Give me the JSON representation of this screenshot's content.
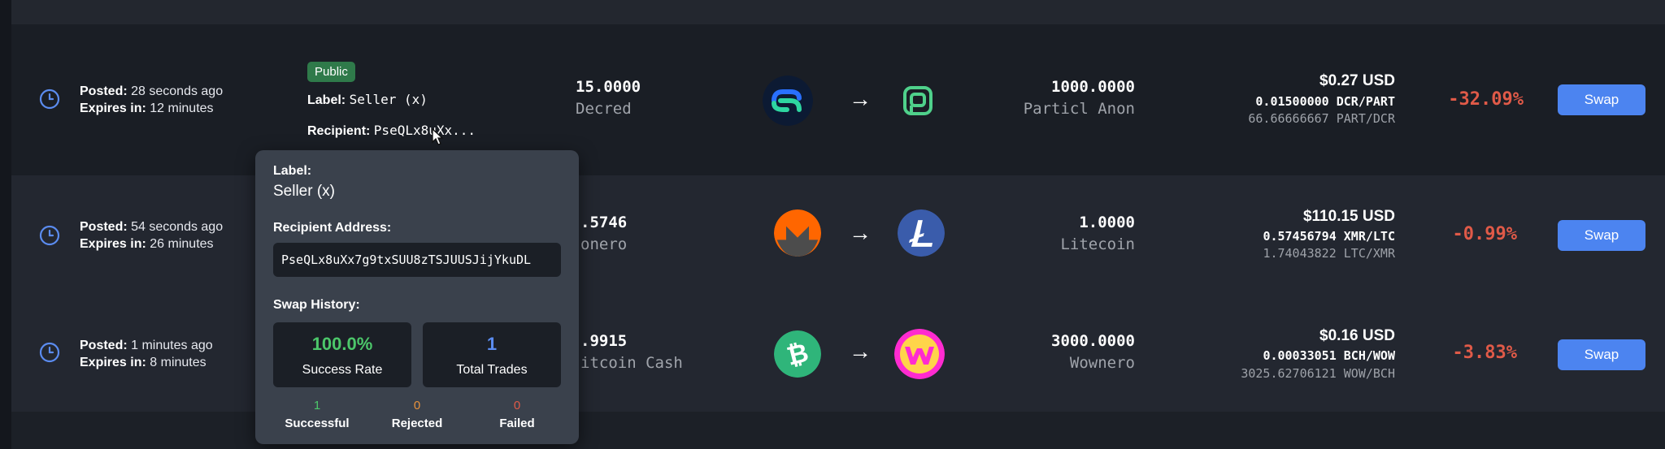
{
  "colors": {
    "background": "#181c24",
    "accent_blue": "#4c84f0",
    "negative": "#e05a48",
    "success_green": "#4cc76a",
    "warning_orange": "#e8923c",
    "failed_red": "#e05a48",
    "public_badge": "#2f7a4a"
  },
  "rows": [
    {
      "posted_label": "Posted:",
      "posted_value": "28 seconds ago",
      "expires_label": "Expires in:",
      "expires_value": "12 minutes",
      "badge": "Public",
      "label_key": "Label:",
      "label_value": "Seller (x)",
      "recipient_key": "Recipient:",
      "recipient_value": "PseQLx8uXx...",
      "from_amount": "15.0000",
      "from_coin": "Decred",
      "from_icon": "decred-icon",
      "arrow": "→",
      "to_amount": "1000.0000",
      "to_coin": "Particl Anon",
      "to_icon": "particl-icon",
      "usd": "$0.27 USD",
      "rate": "0.01500000 DCR/PART",
      "inverse_rate": "66.66666667 PART/DCR",
      "percent": "-32.09%",
      "swap_label": "Swap"
    },
    {
      "posted_label": "Posted:",
      "posted_value": "54 seconds ago",
      "expires_label": "Expires in:",
      "expires_value": "26 minutes",
      "from_amount_partial": ".5746",
      "from_coin_partial": "onero",
      "from_icon": "monero-icon",
      "arrow": "→",
      "to_amount": "1.0000",
      "to_coin": "Litecoin",
      "to_icon": "litecoin-icon",
      "usd": "$110.15 USD",
      "rate": "0.57456794 XMR/LTC",
      "inverse_rate": "1.74043822 LTC/XMR",
      "percent": "-0.99%",
      "swap_label": "Swap"
    },
    {
      "posted_label": "Posted:",
      "posted_value": "1 minutes ago",
      "expires_label": "Expires in:",
      "expires_value": "8 minutes",
      "from_amount_partial": ".9915",
      "from_coin_partial": "itcoin Cash",
      "from_icon": "bitcoin-cash-icon",
      "arrow": "→",
      "to_amount": "3000.0000",
      "to_coin": "Wownero",
      "to_icon": "wownero-icon",
      "usd": "$0.16 USD",
      "rate": "0.00033051 BCH/WOW",
      "inverse_rate": "3025.62706121 WOW/BCH",
      "percent": "-3.83%",
      "swap_label": "Swap"
    }
  ],
  "tooltip": {
    "label_heading": "Label:",
    "label_value": "Seller (x)",
    "address_heading": "Recipient Address:",
    "address_value": "PseQLx8uXx7g9txSUU8zTSJUUSJijYkuDL",
    "history_heading": "Swap History:",
    "success_rate_value": "100.0%",
    "success_rate_label": "Success Rate",
    "total_trades_value": "1",
    "total_trades_label": "Total Trades",
    "successful_count": "1",
    "successful_label": "Successful",
    "rejected_count": "0",
    "rejected_label": "Rejected",
    "failed_count": "0",
    "failed_label": "Failed"
  }
}
